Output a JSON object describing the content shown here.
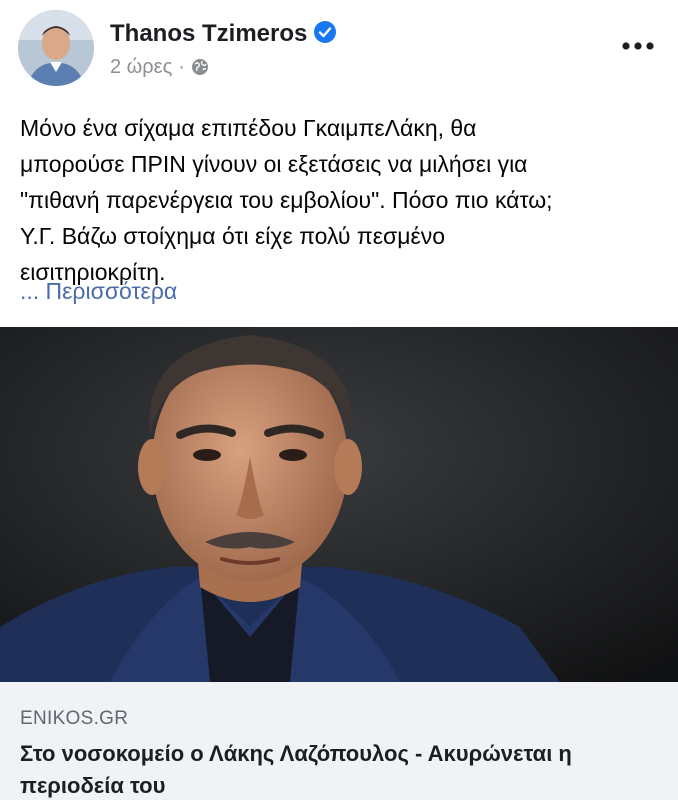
{
  "post": {
    "author": "Thanos Tzimeros",
    "timestamp": "2 ώρες",
    "separator": "·",
    "audience_icon": "globe-icon",
    "verified_icon": "verified-badge-icon",
    "more_icon": "more-options-icon",
    "text_lines": [
      "Μόνο ένα σίχαμα επιπέδου ΓκαιμπεΛάκη, θα",
      "μπορούσε ΠΡΙΝ γίνουν οι εξετάσεις να μιλήσει για",
      "\"πιθανή παρενέργεια του εμβολίου\". Πόσο πιο κάτω;",
      "Υ.Γ. Βάζω στοίχημα ότι είχε πολύ πεσμένο",
      "εισιτηριοκρίτη."
    ],
    "see_more": "... Περισσότερα"
  },
  "link": {
    "domain": "ENIKOS.GR",
    "title": "Στο νοσοκομείο ο Λάκης Λαζόπουλος - Ακυρώνεται η περιοδεία του"
  },
  "colors": {
    "verified": "#1877f2",
    "see_more": "#4b6ca8",
    "preview_bg": "#f0f2f5"
  }
}
